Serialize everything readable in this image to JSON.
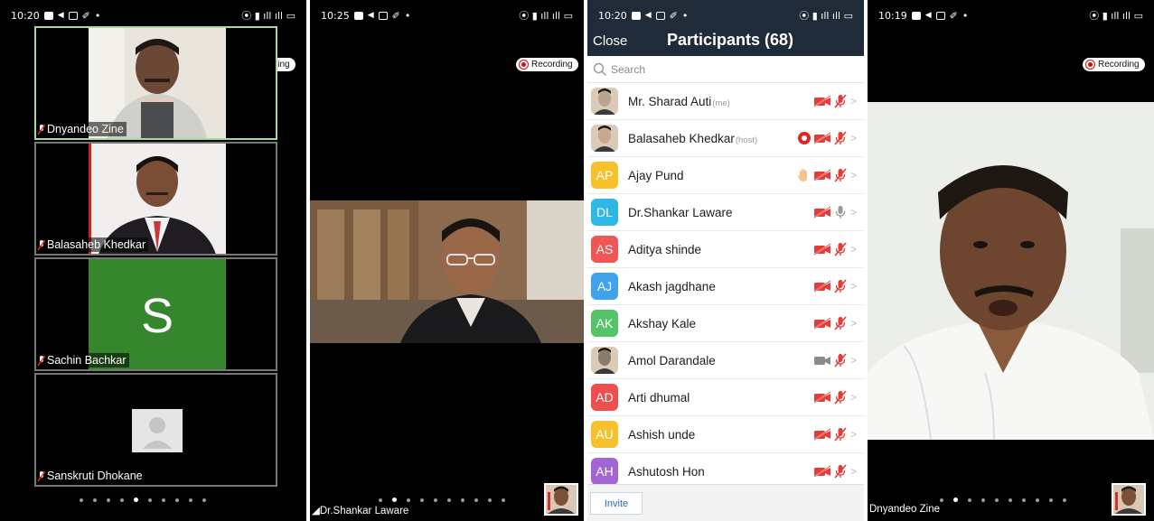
{
  "panel1": {
    "time": "10:20",
    "recording_label": "Recording",
    "tiles": [
      {
        "name": "Dnyandeo Zine"
      },
      {
        "name": "Balasaheb Khedkar"
      },
      {
        "name": "Sachin Bachkar",
        "initial": "S"
      },
      {
        "name": "Sanskruti Dhokane"
      }
    ],
    "page_dots": 10,
    "active_dot": 4
  },
  "panel2": {
    "time": "10:25",
    "recording_label": "Recording",
    "speaker_name": "Dr.Shankar Laware",
    "page_dots": 10,
    "active_dot": 1
  },
  "panel3": {
    "time": "10:20",
    "close_label": "Close",
    "title": "Participants (68)",
    "search_placeholder": "Search",
    "invite_label": "Invite",
    "participants": [
      {
        "name": "Mr. Sharad Auti",
        "role": "(me)",
        "initials": "",
        "color": "#b9a48f",
        "video": "off",
        "mic": "off"
      },
      {
        "name": "Balasaheb Khedkar",
        "role": "(host)",
        "initials": "",
        "color": "#c9a890",
        "video": "off",
        "mic": "off",
        "recording": true
      },
      {
        "name": "Ajay Pund",
        "role": "",
        "initials": "AP",
        "color": "#f7c12b",
        "video": "off",
        "mic": "off",
        "hand": true
      },
      {
        "name": "Dr.Shankar Laware",
        "role": "",
        "initials": "DL",
        "color": "#31b7e6",
        "video": "off",
        "mic": "on"
      },
      {
        "name": "Aditya shinde",
        "role": "",
        "initials": "AS",
        "color": "#ef5656",
        "video": "off",
        "mic": "off"
      },
      {
        "name": "Akash jagdhane",
        "role": "",
        "initials": "AJ",
        "color": "#40a3ea",
        "video": "off",
        "mic": "off"
      },
      {
        "name": "Akshay Kale",
        "role": "",
        "initials": "AK",
        "color": "#55c469",
        "video": "off",
        "mic": "off"
      },
      {
        "name": "Amol Darandale",
        "role": "",
        "initials": "",
        "color": "#8c7a6a",
        "video": "on",
        "mic": "off"
      },
      {
        "name": "Arti dhumal",
        "role": "",
        "initials": "AD",
        "color": "#ef4e4e",
        "video": "off",
        "mic": "off"
      },
      {
        "name": "Ashish unde",
        "role": "",
        "initials": "AU",
        "color": "#f7c12b",
        "video": "off",
        "mic": "off"
      },
      {
        "name": "Ashutosh Hon",
        "role": "",
        "initials": "AH",
        "color": "#a365d4",
        "video": "off",
        "mic": "off"
      }
    ]
  },
  "panel4": {
    "time": "10:19",
    "recording_label": "Recording",
    "speaker_name": "Dnyandeo Zine",
    "page_dots": 10,
    "active_dot": 1
  }
}
